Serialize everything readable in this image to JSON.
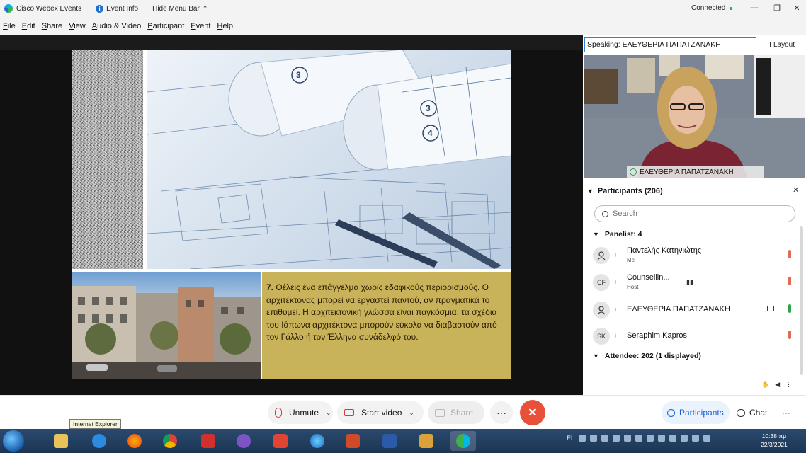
{
  "titlebar": {
    "app_title": "Cisco Webex Events",
    "event_info": "Event Info",
    "hide_menu": "Hide Menu Bar",
    "status": "Connected"
  },
  "menu": [
    "File",
    "Edit",
    "Share",
    "View",
    "Audio & Video",
    "Participant",
    "Event",
    "Help"
  ],
  "slide": {
    "caption_number": "7.",
    "caption_text": "Θέλεις ένα επάγγελμα χωρίς εδαφικούς περιορισμούς. Ο αρχιτέκτονας μπορεί να εργαστεί παντού, αν πραγματικά το επιθυμεί. Η αρχιτεκτονική γλώσσα είναι παγκόσμια, τα σχέδια του Ιάπωνα αρχιτέκτονα μπορούν εύκολα να διαβαστούν από τον Γάλλο ή τον Έλληνα συνάδελφό του.",
    "circle_labels": [
      "3",
      "3",
      "4"
    ]
  },
  "speaking": {
    "label": "Speaking: ΕΛΕΥΘΕΡΙΑ ΠΑΠΑΤΖΑΝΑΚΗ",
    "layout_label": "Layout",
    "video_name": "ΕΛΕΥΘΕΡΙΑ ΠΑΠΑΤΖΑΝΑΚΗ"
  },
  "participants": {
    "header": "Participants (206)",
    "search_placeholder": "Search",
    "panelist_group": "Panelist: 4",
    "attendee_group": "Attendee: 202 (1 displayed)",
    "rows": [
      {
        "initials": "",
        "name": "Παντελής Κατηνιώτης",
        "role": "Me"
      },
      {
        "initials": "CF",
        "name": "Counsellin...",
        "role": "Host"
      },
      {
        "initials": "",
        "name": "ΕΛΕΥΘΕΡΙΑ ΠΑΠΑΤΖΑΝΑΚΗ",
        "role": ""
      },
      {
        "initials": "SK",
        "name": "Seraphim Kapros",
        "role": ""
      }
    ]
  },
  "controls": {
    "unmute": "Unmute",
    "start_video": "Start video",
    "share": "Share",
    "more": "···",
    "leave": "✕",
    "participants": "Participants",
    "chat": "Chat"
  },
  "tooltip": "Internet Explorer",
  "taskbar": {
    "language": "EL",
    "time": "10:38 πμ",
    "date": "22/3/2021"
  },
  "colors": {
    "accent": "#1a5fd1",
    "leave": "#e8503a",
    "caption_bg": "#c9b35a"
  }
}
